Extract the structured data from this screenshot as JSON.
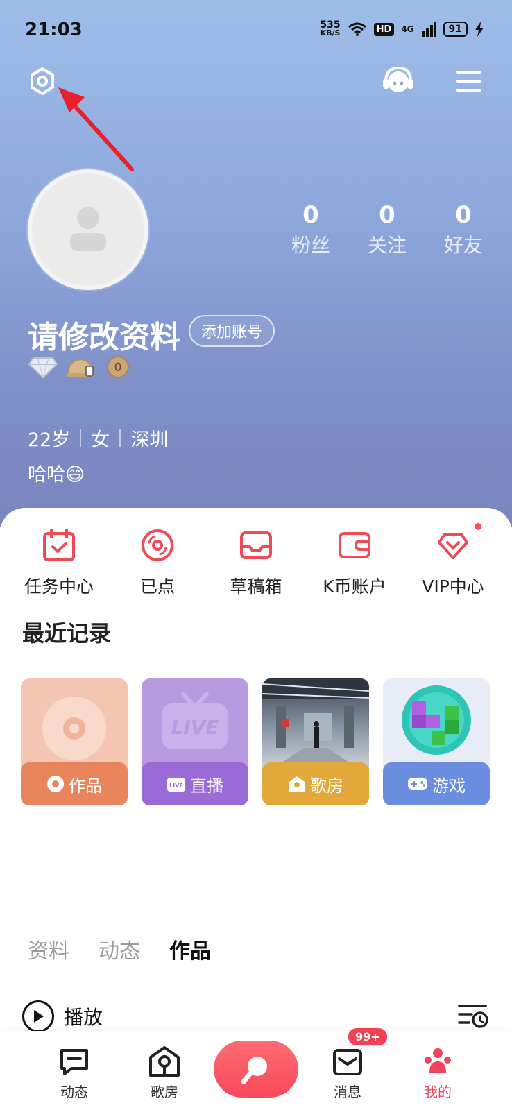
{
  "status_bar": {
    "time": "21:03",
    "net_speed_value": "535",
    "net_speed_unit": "KB/S",
    "hd": "HD",
    "network": "4G",
    "battery": "91"
  },
  "profile": {
    "nickname": "请修改资料",
    "add_account": "添加账号",
    "level_coin": "0",
    "stats": [
      {
        "num": "0",
        "label": "粉丝"
      },
      {
        "num": "0",
        "label": "关注"
      },
      {
        "num": "0",
        "label": "好友"
      }
    ],
    "age": "22岁",
    "gender": "女",
    "city": "深圳",
    "bio": "哈哈😄"
  },
  "quick_actions": [
    {
      "label": "任务中心"
    },
    {
      "label": "已点"
    },
    {
      "label": "草稿箱"
    },
    {
      "label": "K币账户"
    },
    {
      "label": "VIP中心"
    }
  ],
  "recent": {
    "title": "最近记录",
    "cards": [
      {
        "label": "作品",
        "art_text": ""
      },
      {
        "label": "直播",
        "art_text": "LIVE",
        "badge": "LIVE"
      },
      {
        "label": "歌房"
      },
      {
        "label": "游戏"
      }
    ]
  },
  "tabs": [
    "资料",
    "动态",
    "作品"
  ],
  "active_tab": "作品",
  "play_label": "播放",
  "bottom_nav": {
    "items": [
      "动态",
      "歌房",
      "消息",
      "我的"
    ],
    "message_badge": "99+",
    "active": "我的"
  },
  "colors": {
    "accent": "#f0445a",
    "hero_top": "#9fbde9",
    "hero_bottom": "#7a85bf"
  }
}
